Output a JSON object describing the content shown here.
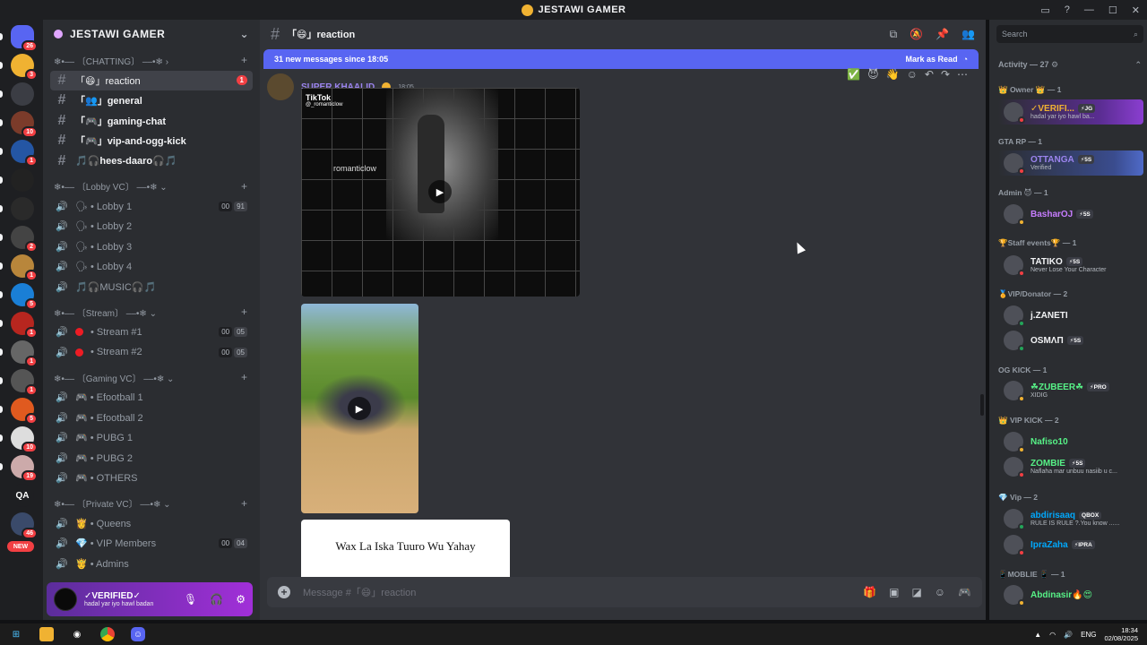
{
  "window": {
    "title": "JESTAWI GAMER"
  },
  "server_rail": {
    "items": [
      {
        "icon": "discord-home-icon",
        "badge": "26"
      },
      {
        "icon": "server-jestawi-icon",
        "badge": "3"
      },
      {
        "icon": "server-blue-icon",
        "badge": ""
      },
      {
        "icon": "server-avatar-icon",
        "badge": "10"
      },
      {
        "icon": "server-speaker-icon",
        "badge": "1"
      },
      {
        "icon": "server-triangle-icon",
        "badge": ""
      },
      {
        "icon": "server-dice-icon",
        "badge": ""
      },
      {
        "icon": "server-anime-icon",
        "badge": "2"
      },
      {
        "icon": "server-crown-icon",
        "badge": "1"
      },
      {
        "icon": "server-c-icon",
        "badge": "5"
      },
      {
        "icon": "server-red-icon",
        "badge": "1"
      },
      {
        "icon": "server-stone-icon",
        "badge": "1"
      },
      {
        "icon": "server-person-icon",
        "badge": "1"
      },
      {
        "icon": "server-orange-icon",
        "badge": "5"
      },
      {
        "icon": "server-tool-icon",
        "badge": "10"
      },
      {
        "icon": "server-girl-icon",
        "badge": "19"
      },
      {
        "icon": "server-qa-icon",
        "badge": "",
        "label": "QA"
      },
      {
        "icon": "server-mail-icon",
        "badge": "46"
      },
      {
        "icon": "server-new-icon",
        "badge": "",
        "label": "NEW"
      }
    ]
  },
  "sidebar": {
    "server_name": "JESTAWI GAMER",
    "categories": [
      {
        "label": "❄•–– 〔CHATTING〕 ––•❄ ›",
        "channels": [
          {
            "name": "「😄」reaction",
            "type": "text",
            "active": true,
            "mention": "1"
          },
          {
            "name": "「👥」general",
            "type": "text",
            "bright": true
          },
          {
            "name": "「🎮」gaming-chat",
            "type": "text",
            "bright": true
          },
          {
            "name": "「🎮」vip-and-ogg-kick",
            "type": "text",
            "bright": true
          },
          {
            "name": "🎵🎧hees-daaro🎧🎵",
            "type": "text",
            "bright": true
          }
        ]
      },
      {
        "label": "❄•–– 〔Lobby VC〕 ––•❄ ⌄",
        "channels": [
          {
            "name": "🗣 • Lobby 1",
            "type": "voice",
            "c1": "00",
            "c2": "91"
          },
          {
            "name": "🗣 • Lobby 2",
            "type": "voice"
          },
          {
            "name": "🗣 • Lobby 3",
            "type": "voice"
          },
          {
            "name": "🗣 • Lobby 4",
            "type": "voice"
          },
          {
            "name": "🎵🎧MUSIC🎧🎵",
            "type": "voice"
          }
        ]
      },
      {
        "label": "❄•–– 〔Stream〕 ––•❄ ⌄",
        "channels": [
          {
            "name": "• Stream #1",
            "type": "voice",
            "dot": true,
            "c1": "00",
            "c2": "05"
          },
          {
            "name": "• Stream #2",
            "type": "voice",
            "dot": true,
            "c1": "00",
            "c2": "05"
          }
        ]
      },
      {
        "label": "❄•–– 〔Gaming VC〕 ––•❄ ⌄",
        "channels": [
          {
            "name": "🎮 • Efootball 1",
            "type": "voice"
          },
          {
            "name": "🎮 • Efootball 2",
            "type": "voice"
          },
          {
            "name": "🎮 • PUBG 1",
            "type": "voice"
          },
          {
            "name": "🎮 • PUBG 2",
            "type": "voice"
          },
          {
            "name": "🎮 • OTHERS",
            "type": "voice"
          }
        ]
      },
      {
        "label": "❄•–– 〔Private VC〕 ––•❄ ⌄",
        "channels": [
          {
            "name": "👸 • Queens",
            "type": "voice"
          },
          {
            "name": "💎 • VIP Members",
            "type": "voice",
            "c1": "00",
            "c2": "04"
          },
          {
            "name": "🤴 • Admins",
            "type": "voice"
          }
        ]
      }
    ]
  },
  "user_panel": {
    "name": "✓VERIFIED✓",
    "status": "hadal yar iyo hawl badan"
  },
  "chat": {
    "channel_name": "「😄」reaction",
    "new_messages": "31 new messages since 18:05",
    "mark_as_read": "Mark as Read",
    "author": "SUPER KHAALID",
    "time": "18:05",
    "tiktok_label": "TikTok",
    "tiktok_handle": "@_romanticlow",
    "watermark": "romanticlow",
    "card_text": "Wax La Iska Tuuro Wu Yahay",
    "composer_placeholder": "Message #「😄」reaction"
  },
  "members": {
    "search_placeholder": "Search",
    "activity": "Activity — 27 ⚙",
    "roles": [
      {
        "label": "👑 Owner 👑 — 1"
      },
      {
        "label": "GTA RP — 1"
      },
      {
        "label": "Admin 😈 — 1"
      },
      {
        "label": "🏆Staff events🏆 — 1"
      },
      {
        "label": "🏅VIP/Donator — 2"
      },
      {
        "label": "OG KICK — 1"
      },
      {
        "label": "👑 VIP KICK — 2"
      },
      {
        "label": "💎 Vip — 2"
      },
      {
        "label": "📱MOBLIE 📱 — 1"
      }
    ],
    "people": [
      {
        "name": "✓VERIFI...",
        "tag": "⚡JG",
        "status": "hadal yar iyo hawl ba...",
        "color": "#f0b232"
      },
      {
        "name": "OTTANGA",
        "tag": "⚡5S",
        "status": "Verified",
        "color": "#9b84ee"
      },
      {
        "name": "BasharOJ",
        "tag": "⚡5S",
        "status": "",
        "color": "#c77dff"
      },
      {
        "name": "TATIKO",
        "tag": "⚡5S",
        "status": "Never Lose Your Character",
        "color": "#f2f3f5"
      },
      {
        "name": "j.ZANETI",
        "tag": "",
        "status": "",
        "color": "#f2f3f5"
      },
      {
        "name": "OSMΛΠ",
        "tag": "⚡5S",
        "status": "",
        "color": "#f2f3f5"
      },
      {
        "name": "☘ZUBEER☘",
        "tag": "⚡PRO",
        "status": "XIDIG",
        "color": "#57f287"
      },
      {
        "name": "Nafiso10",
        "tag": "",
        "status": "",
        "color": "#57f287"
      },
      {
        "name": "ZOMBIE",
        "tag": "⚡5S",
        "status": "Naflaha mar unbuu nasiib u c...",
        "color": "#57f287"
      },
      {
        "name": "abdirisaaq",
        "tag": "QBOX",
        "status": "RULE IS RULE ?.You know ......",
        "color": "#00a8fc"
      },
      {
        "name": "IpraZaha",
        "tag": "⚡IPRA",
        "status": "",
        "color": "#00a8fc"
      },
      {
        "name": "Abdinasir🔥😍",
        "tag": "",
        "status": "",
        "color": "#57f287"
      }
    ]
  },
  "taskbar": {
    "lang": "ENG",
    "time": "18:34",
    "date": "02/08/2025"
  }
}
